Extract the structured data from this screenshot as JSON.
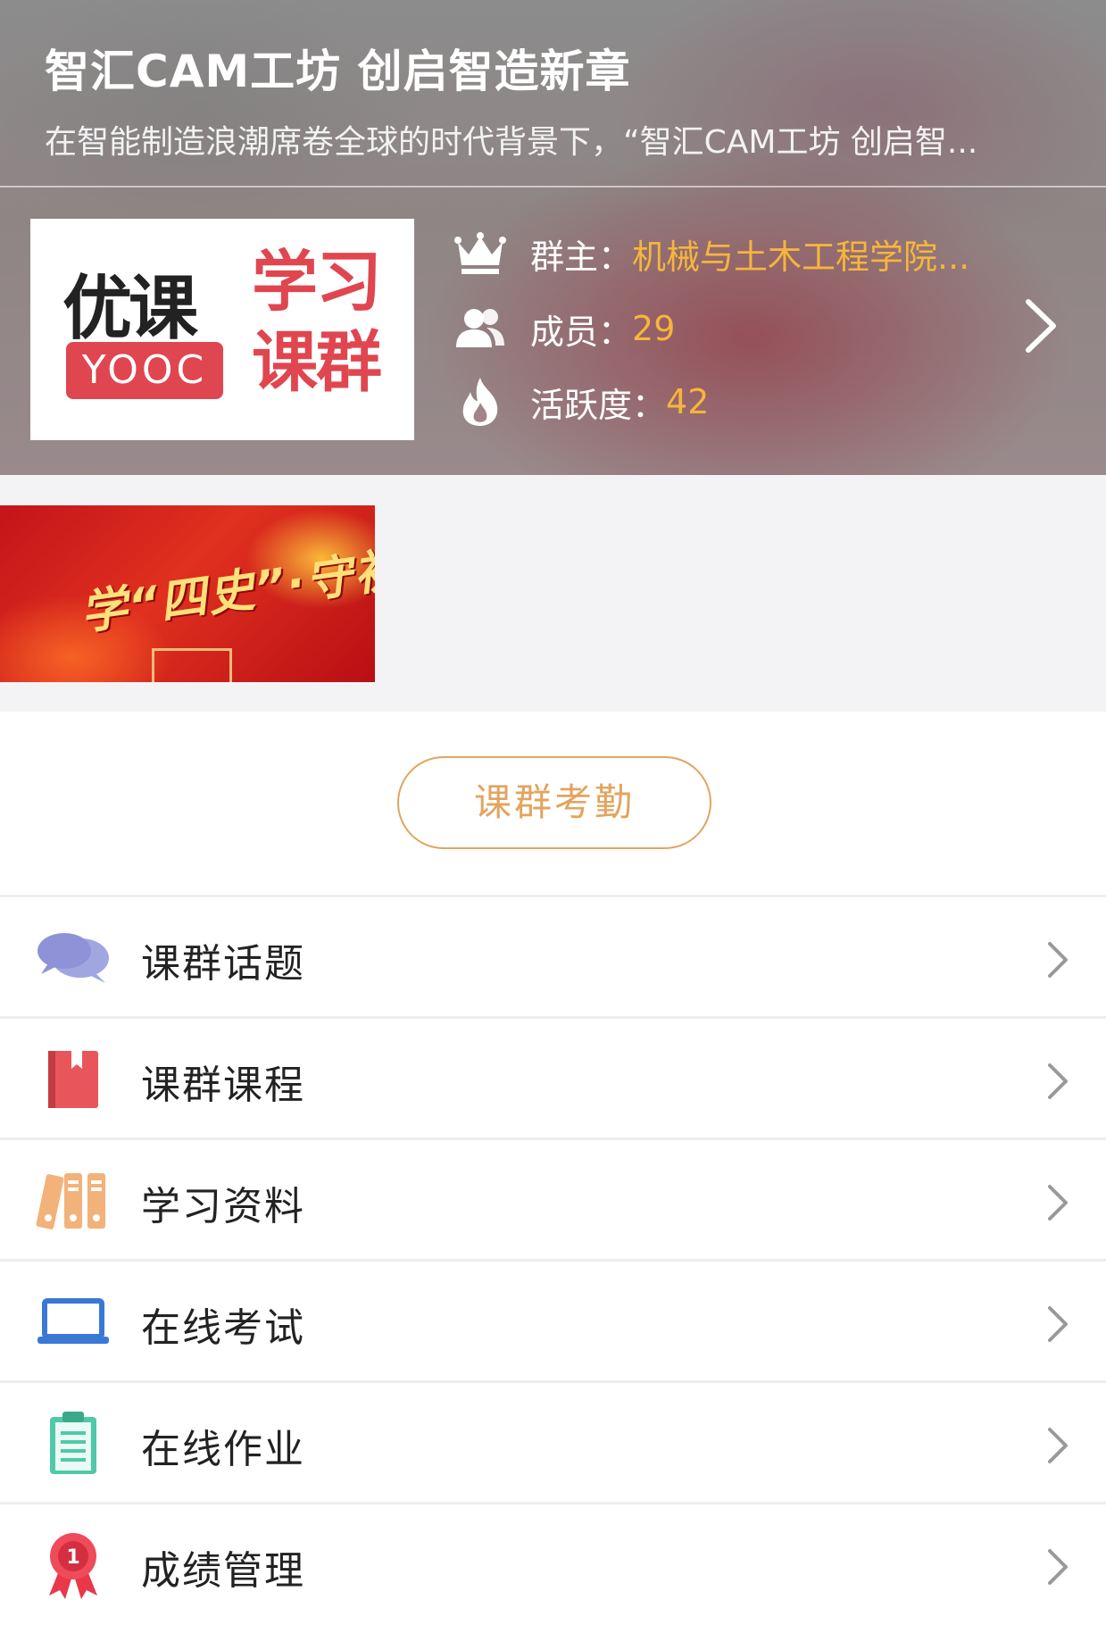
{
  "header": {
    "title": "智汇CAM工坊 创启智造新章",
    "description": "在智能制造浪潮席卷全球的时代背景下，“智汇CAM工坊 创启智..."
  },
  "logo": {
    "brand_cn": "优课",
    "brand_en": "YOOC",
    "tagline_line1": "学习",
    "tagline_line2": "课群"
  },
  "group_info": {
    "owner_label": "群主：",
    "owner_value": "机械与土木工程学院...",
    "members_label": "成员：",
    "members_value": "29",
    "activity_label": "活跃度：",
    "activity_value": "42"
  },
  "banner": {
    "text": "学“四史”·守初心"
  },
  "attendance_button": "课群考勤",
  "menu": [
    {
      "label": "课群话题",
      "icon": "chat-bubbles-icon"
    },
    {
      "label": "课群课程",
      "icon": "book-icon"
    },
    {
      "label": "学习资料",
      "icon": "binders-icon"
    },
    {
      "label": "在线考试",
      "icon": "laptop-icon"
    },
    {
      "label": "在线作业",
      "icon": "clipboard-icon"
    },
    {
      "label": "成绩管理",
      "icon": "award-ribbon-icon"
    }
  ],
  "colors": {
    "accent_gold": "#f6b53c",
    "attendance_orange": "#e2a45f",
    "brand_red": "#e0464f"
  }
}
